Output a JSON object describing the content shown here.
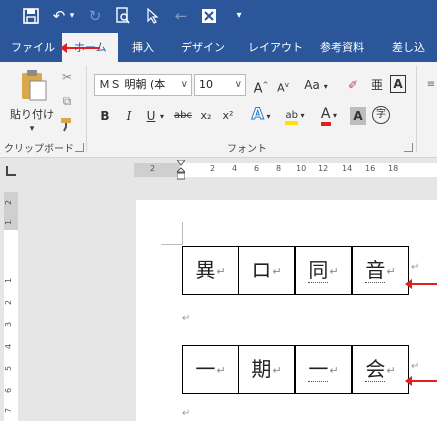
{
  "qat": {
    "save_icon": "save-icon",
    "undo_icon": "undo-icon",
    "redo_icon": "redo-icon",
    "print_preview_icon": "print-preview-icon",
    "pointer_icon": "pointer-icon",
    "back_icon": "back-icon",
    "excel_icon": "excel-icon",
    "customize_icon": "customize-icon"
  },
  "tabs": [
    {
      "label": "ファイル"
    },
    {
      "label": "ホーム"
    },
    {
      "label": "挿入"
    },
    {
      "label": "デザイン"
    },
    {
      "label": "レイアウト"
    },
    {
      "label": "参考資料"
    },
    {
      "label": "差し込"
    }
  ],
  "ribbon": {
    "paste_label": "貼り付け",
    "clipboard_group": "クリップボード",
    "font_group": "フォント",
    "font_name": "ＭＳ 明朝 (本",
    "font_size": "10",
    "grow_label": "A",
    "shrink_label": "A",
    "case_label": "Aa",
    "bold": "B",
    "italic": "I",
    "underline": "U",
    "strike": "abc",
    "subscript": "x₂",
    "superscript": "x²",
    "text_effect": "A",
    "highlight": "ab",
    "font_color": "A",
    "char_shading": "A",
    "enclosed": "字",
    "char_border": "A"
  },
  "ruler": {
    "h_ticks": [
      "2",
      "2",
      "4",
      "6",
      "8",
      "10",
      "12",
      "14",
      "16",
      "18"
    ],
    "v_ticks": [
      "2",
      "1",
      "1",
      "2",
      "3",
      "4",
      "5",
      "6",
      "7"
    ]
  },
  "document": {
    "table1": [
      "異",
      "ロ",
      "同",
      "音"
    ],
    "table2": [
      "一",
      "期",
      "一",
      "会"
    ],
    "paragraph_mark": "↵"
  },
  "colors": {
    "accent": "#2b579a",
    "annotation_red": "#e02020"
  }
}
